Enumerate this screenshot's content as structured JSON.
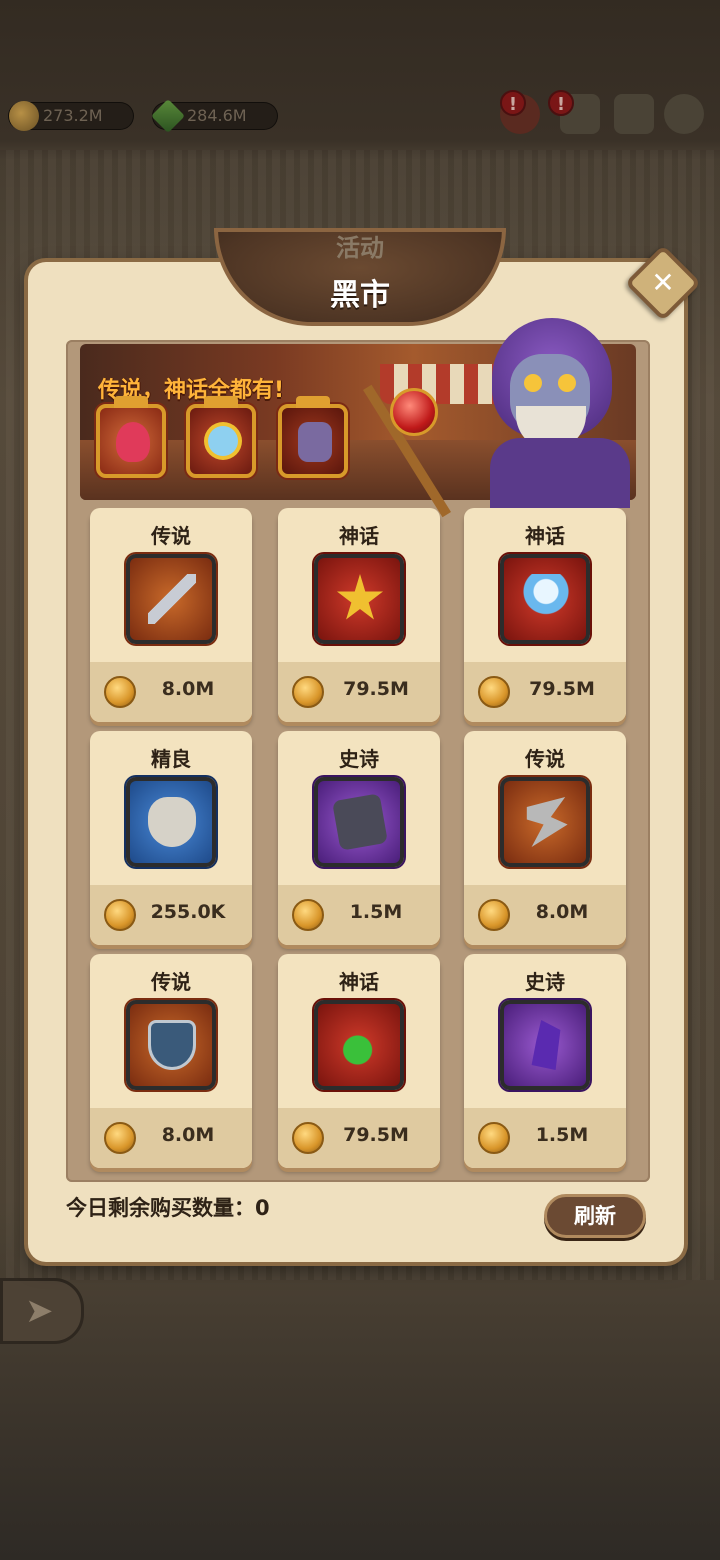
{
  "resources": {
    "gold": "273.2M",
    "gems": "284.6M"
  },
  "header_icons": [
    {
      "name": "treasure-chest",
      "alert": "!"
    },
    {
      "name": "chat",
      "alert": "!"
    },
    {
      "name": "mail"
    },
    {
      "name": "settings"
    }
  ],
  "modal": {
    "tab_label": "活动",
    "title": "黑市",
    "close_label": "✕"
  },
  "banner": {
    "tagline": "传说，神话全都有!"
  },
  "shop": {
    "items": [
      {
        "rarity": "传说",
        "price": "8.0M",
        "icon": "sword-icon"
      },
      {
        "rarity": "神话",
        "price": "79.5M",
        "icon": "star-icon"
      },
      {
        "rarity": "神话",
        "price": "79.5M",
        "icon": "magic-wand-icon"
      },
      {
        "rarity": "精良",
        "price": "255.0K",
        "icon": "mask-icon"
      },
      {
        "rarity": "史诗",
        "price": "1.5M",
        "icon": "dark-relic-icon"
      },
      {
        "rarity": "传说",
        "price": "8.0M",
        "icon": "claw-blade-icon"
      },
      {
        "rarity": "传说",
        "price": "8.0M",
        "icon": "shield-icon"
      },
      {
        "rarity": "神话",
        "price": "79.5M",
        "icon": "amulet-icon"
      },
      {
        "rarity": "史诗",
        "price": "1.5M",
        "icon": "crystal-pendant-icon"
      }
    ],
    "remaining_label": "今日剩余购买数量：0",
    "refresh_label": "刷新"
  },
  "colors": {
    "legendary": "#ec9a28",
    "mythic": "#cf3a2a",
    "epic": "#9a5ad0",
    "fine": "#4a8ad8",
    "panel": "#efe0bf"
  }
}
